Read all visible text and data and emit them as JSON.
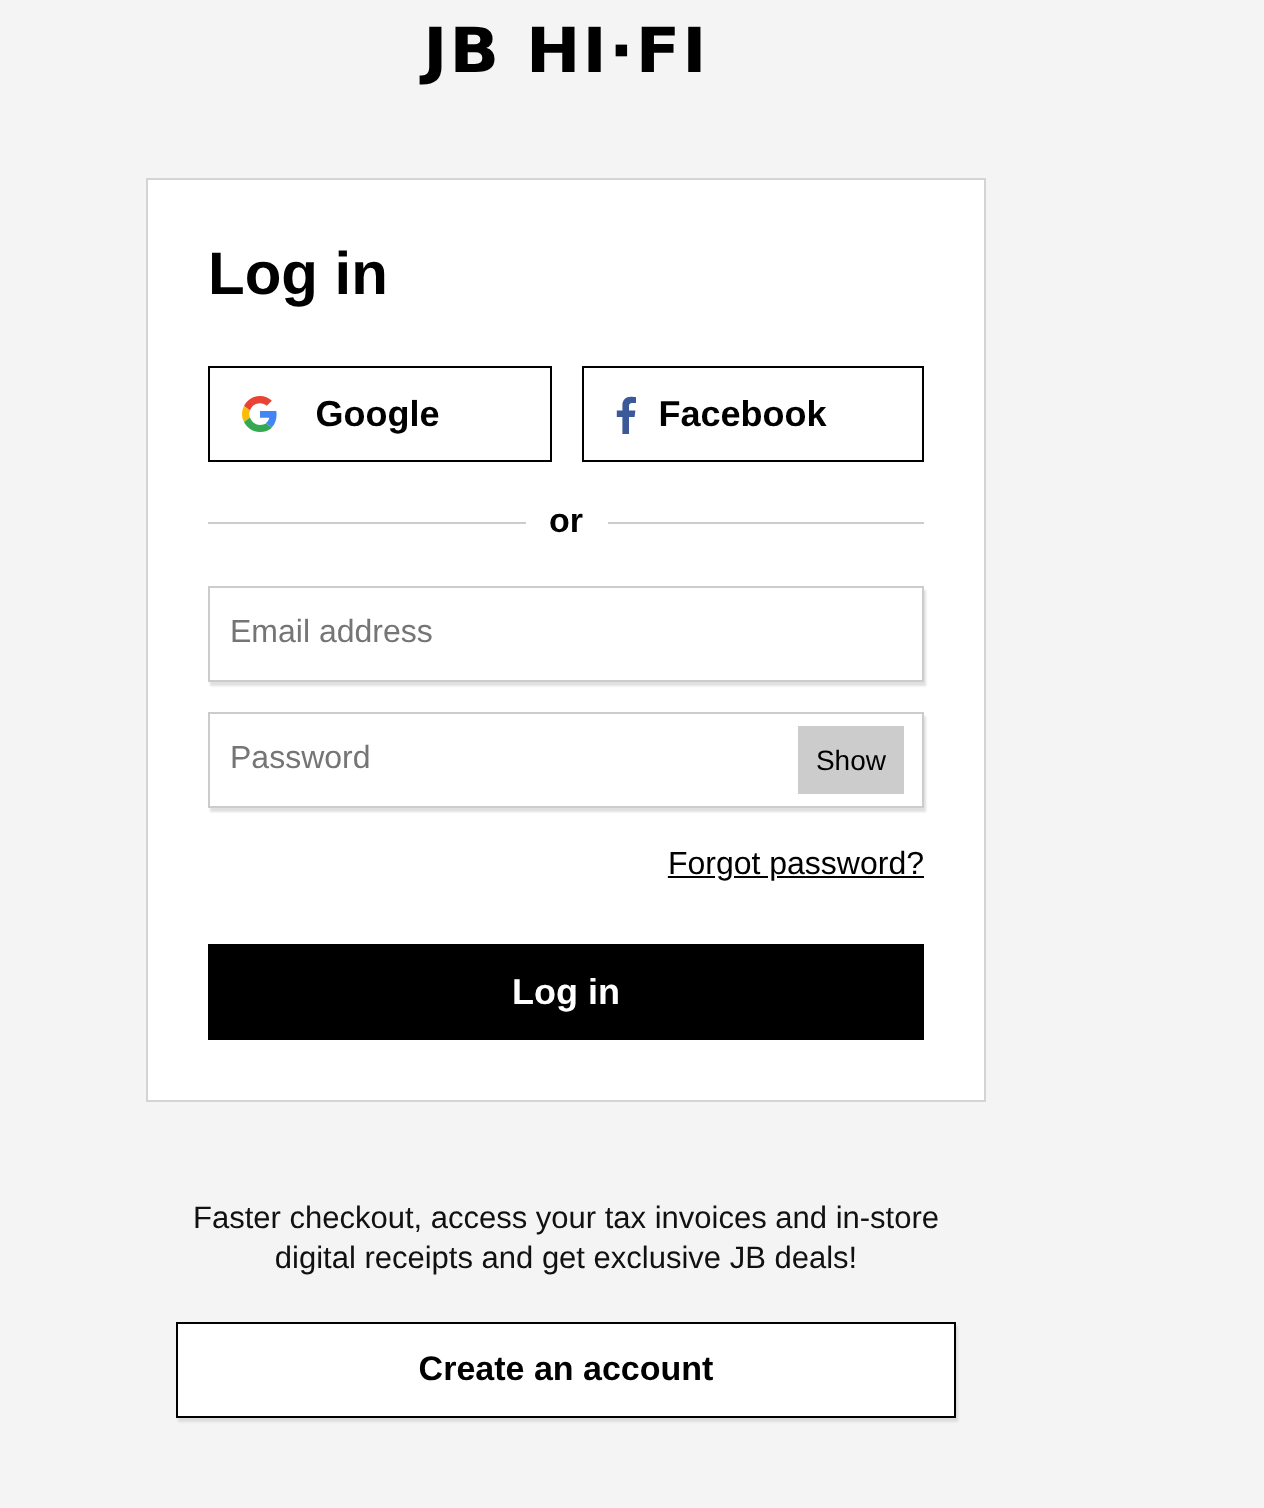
{
  "logo": "JB HI·FI",
  "card": {
    "title": "Log in",
    "social": [
      {
        "kind": "google",
        "label": "Google"
      },
      {
        "kind": "facebook",
        "label": "Facebook"
      }
    ],
    "divider": "or",
    "email": {
      "placeholder": "Email address"
    },
    "password": {
      "placeholder": "Password",
      "toggle": "Show"
    },
    "forgot": "Forgot password?",
    "submit": "Log in"
  },
  "promo": "Faster checkout, access your tax invoices and in-store digital receipts and get exclusive JB deals!",
  "create": "Create an account"
}
